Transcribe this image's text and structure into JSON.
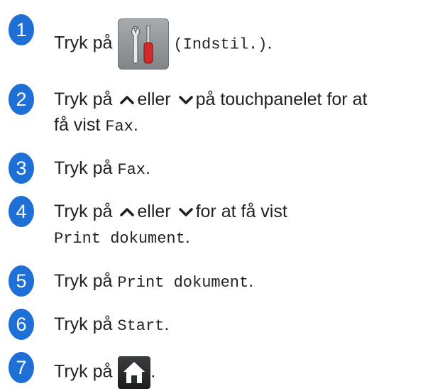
{
  "colors": {
    "step_badge": "#1e6fd6",
    "text": "#231f20"
  },
  "steps": [
    {
      "number": "1",
      "pre": "Tryk på",
      "icon": "settings-wrench-screwdriver-icon",
      "mono": "(Indstil.)",
      "post": "."
    },
    {
      "number": "2",
      "pre": "Tryk på",
      "up": "chevron-up-icon",
      "mid": "eller",
      "down": "chevron-down-icon",
      "post": "på touchpanelet for at",
      "line2_pre": "få vist",
      "line2_mono": "Fax",
      "line2_post": "."
    },
    {
      "number": "3",
      "pre": "Tryk på",
      "mono": "Fax",
      "post": "."
    },
    {
      "number": "4",
      "pre": "Tryk på",
      "up": "chevron-up-icon",
      "mid": "eller",
      "down": "chevron-down-icon",
      "post": "for at få vist",
      "line2_mono": "Print dokument",
      "line2_post": "."
    },
    {
      "number": "5",
      "pre": "Tryk på",
      "mono": "Print dokument",
      "post": "."
    },
    {
      "number": "6",
      "pre": "Tryk på",
      "mono": "Start",
      "post": "."
    },
    {
      "number": "7",
      "pre": "Tryk på",
      "icon": "home-icon",
      "post": "."
    }
  ]
}
